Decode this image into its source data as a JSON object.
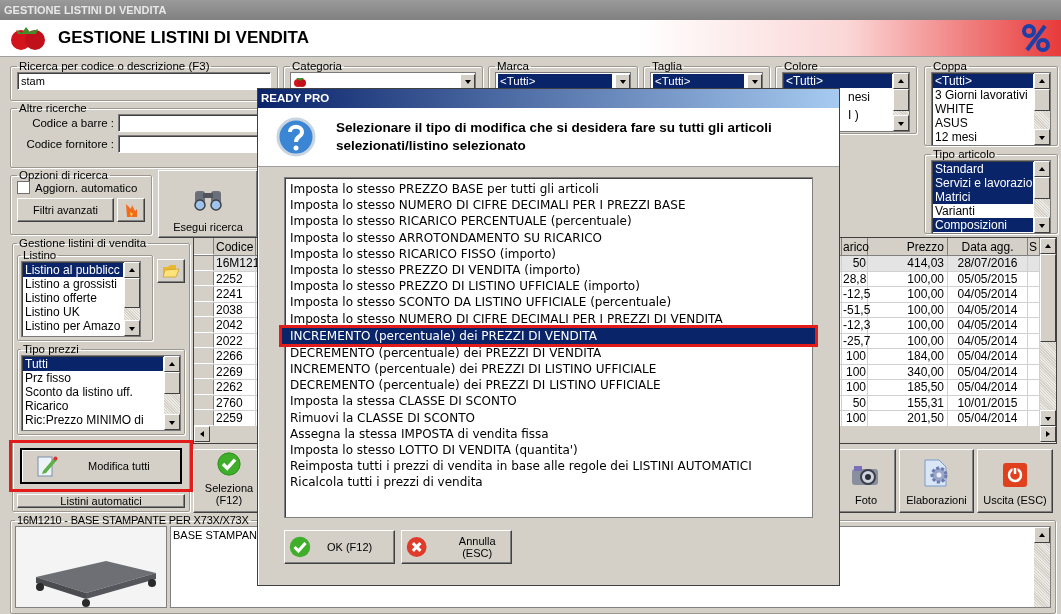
{
  "window": {
    "title": "GESTIONE LISTINI DI VENDITA"
  },
  "header": {
    "title": "GESTIONE LISTINI DI VENDITA"
  },
  "search": {
    "label": "Ricerca per codice o descrizione (F3)",
    "value": "stam"
  },
  "other_searches": {
    "label": "Altre ricerche",
    "fields": [
      {
        "label": "Codice a barre :"
      },
      {
        "label": "Codice fornitore :"
      }
    ]
  },
  "search_options": {
    "label": "Opzioni di ricerca",
    "auto_update": {
      "label": "Aggiorn. automatico",
      "checked": false
    },
    "advanced_button": "Filtri avanzati"
  },
  "run_search_button": "Esegui ricerca",
  "filters": [
    {
      "kind": "combo",
      "label": "Categoria"
    },
    {
      "kind": "combo",
      "label": "Marca",
      "value": "<Tutti>"
    },
    {
      "kind": "combo",
      "label": "Taglia",
      "value": "<Tutti>"
    },
    {
      "kind": "list",
      "label": "Colore",
      "items": [
        {
          "text": "<Tutti>",
          "selected": true
        },
        {
          "text": "nesi",
          "selected": false
        },
        {
          "text": "I )",
          "selected": false
        }
      ]
    }
  ],
  "side_filters": [
    {
      "label": "Coppa",
      "items": [
        {
          "text": "<Tutti>",
          "selected": true
        },
        {
          "text": "3 Giorni lavorativi",
          "selected": false
        },
        {
          "text": "WHITE",
          "selected": false
        },
        {
          "text": "ASUS",
          "selected": false
        },
        {
          "text": "12 mesi",
          "selected": false
        }
      ]
    },
    {
      "label": "Tipo articolo",
      "items": [
        {
          "text": "Standard",
          "selected": true
        },
        {
          "text": "Servizi e lavorazio",
          "selected": true
        },
        {
          "text": "Matrici",
          "selected": true
        },
        {
          "text": "Varianti",
          "selected": false
        },
        {
          "text": "Composizioni",
          "selected": true
        }
      ]
    }
  ],
  "price_lists": {
    "label": "Gestione listini di vendita",
    "listino": {
      "label": "Listino",
      "items": [
        {
          "text": "Listino al pubblicc",
          "selected": true
        },
        {
          "text": "Listino a grossisti",
          "selected": false
        },
        {
          "text": "Listino offerte",
          "selected": false
        },
        {
          "text": "Listino UK",
          "selected": false
        },
        {
          "text": "Listino per Amazo",
          "selected": false
        }
      ]
    },
    "price_types": {
      "label": "Tipo prezzi",
      "items": [
        {
          "text": "Tutti",
          "selected": true
        },
        {
          "text": "Prz fisso",
          "selected": false
        },
        {
          "text": "Sconto da listino uff.",
          "selected": false
        },
        {
          "text": "Ricarico",
          "selected": false
        },
        {
          "text": "Ric:Prezzo MINIMO di",
          "selected": false
        }
      ]
    },
    "edit_all_button": {
      "label": "Modifica tutti",
      "highlighted": true
    },
    "auto_lists_button": "Listini automatici"
  },
  "table": {
    "columns": [
      "Codice",
      "arico",
      "Prezzo",
      "Data agg.",
      "S"
    ],
    "rows": [
      {
        "selected": true,
        "cells": [
          "16M121",
          "50",
          "414,03",
          "28/07/2016"
        ]
      },
      {
        "selected": false,
        "cells": [
          "2252",
          "28,8",
          "100,00",
          "05/05/2015"
        ]
      },
      {
        "selected": false,
        "cells": [
          "2241",
          "-12,5",
          "100,00",
          "04/05/2014"
        ]
      },
      {
        "selected": false,
        "cells": [
          "2038",
          "-51,5",
          "100,00",
          "04/05/2014"
        ]
      },
      {
        "selected": false,
        "cells": [
          "2042",
          "-12,3",
          "100,00",
          "04/05/2014"
        ]
      },
      {
        "selected": false,
        "cells": [
          "2022",
          "-25,7",
          "100,00",
          "04/05/2014"
        ]
      },
      {
        "selected": false,
        "cells": [
          "2266",
          "100",
          "184,00",
          "05/04/2014"
        ]
      },
      {
        "selected": false,
        "cells": [
          "2269",
          "100",
          "340,00",
          "05/04/2014"
        ]
      },
      {
        "selected": false,
        "cells": [
          "2262",
          "100",
          "185,50",
          "05/04/2014"
        ]
      },
      {
        "selected": false,
        "cells": [
          "2760",
          "50",
          "155,31",
          "10/01/2015"
        ]
      },
      {
        "selected": false,
        "cells": [
          "2259",
          "100",
          "201,50",
          "05/04/2014"
        ]
      }
    ]
  },
  "actions": [
    {
      "kind": "select",
      "label": "Seleziona (F12)"
    },
    {
      "label": "Foto"
    },
    {
      "kind": "processing",
      "label": "Elaborazioni"
    },
    {
      "kind": "exit",
      "label": "Uscita (ESC)"
    }
  ],
  "detail": {
    "label": "16M1210 - BASE STAMPANTE PER X73X/X73X",
    "description": "BASE STAMPAN"
  },
  "dialog": {
    "title": "READY PRO",
    "message": "Selezionare il tipo di modifica che si desidera fare su tutti gli articoli selezionati/listino selezionato",
    "options": [
      {
        "text": "Imposta lo stesso PREZZO BASE per tutti gli articoli",
        "selected": false
      },
      {
        "text": "Imposta lo stesso NUMERO DI CIFRE DECIMALI PER I PREZZI BASE",
        "selected": false
      },
      {
        "text": "Imposta lo stesso RICARICO PERCENTUALE (percentuale)",
        "selected": false
      },
      {
        "text": "Imposta lo stesso ARROTONDAMENTO SU RICARICO",
        "selected": false
      },
      {
        "text": "Imposta lo stesso RICARICO FISSO (importo)",
        "selected": false
      },
      {
        "text": "Imposta lo stesso PREZZO DI VENDITA (importo)",
        "selected": false
      },
      {
        "text": "Imposta lo stesso PREZZO DI LISTINO UFFICIALE (importo)",
        "selected": false
      },
      {
        "text": "Imposta lo stesso SCONTO DA LISTINO UFFICIALE (percentuale)",
        "selected": false
      },
      {
        "text": "Imposta lo stesso NUMERO DI CIFRE DECIMALI PER I PREZZI DI VENDITA",
        "selected": false
      },
      {
        "text": "INCREMENTO (percentuale) dei PREZZI DI VENDITA",
        "selected": true,
        "highlighted": true
      },
      {
        "text": "DECREMENTO (percentuale) dei PREZZI DI VENDITA",
        "selected": false
      },
      {
        "text": "INCREMENTO (percentuale) dei PREZZI DI LISTINO UFFICIALE",
        "selected": false
      },
      {
        "text": "DECREMENTO (percentuale) dei PREZZI DI LISTINO UFFICIALE",
        "selected": false
      },
      {
        "text": "Imposta la stessa CLASSE DI SCONTO",
        "selected": false
      },
      {
        "text": "Rimuovi la CLASSE DI SCONTO",
        "selected": false
      },
      {
        "text": "Assegna la stessa IMPOSTA di vendita fissa",
        "selected": false
      },
      {
        "text": "Imposta lo stesso LOTTO DI VENDITA (quantita')",
        "selected": false
      },
      {
        "text": "Reimposta tutti i prezzi di vendita in base alle regole dei LISTINI AUTOMATICI",
        "selected": false
      },
      {
        "text": "Ricalcola tutti i prezzi di vendita",
        "selected": false
      }
    ],
    "buttons": [
      {
        "kind": "ok",
        "label": "OK (F12)"
      },
      {
        "kind": "cancel",
        "label": "Annulla (ESC)"
      }
    ]
  }
}
